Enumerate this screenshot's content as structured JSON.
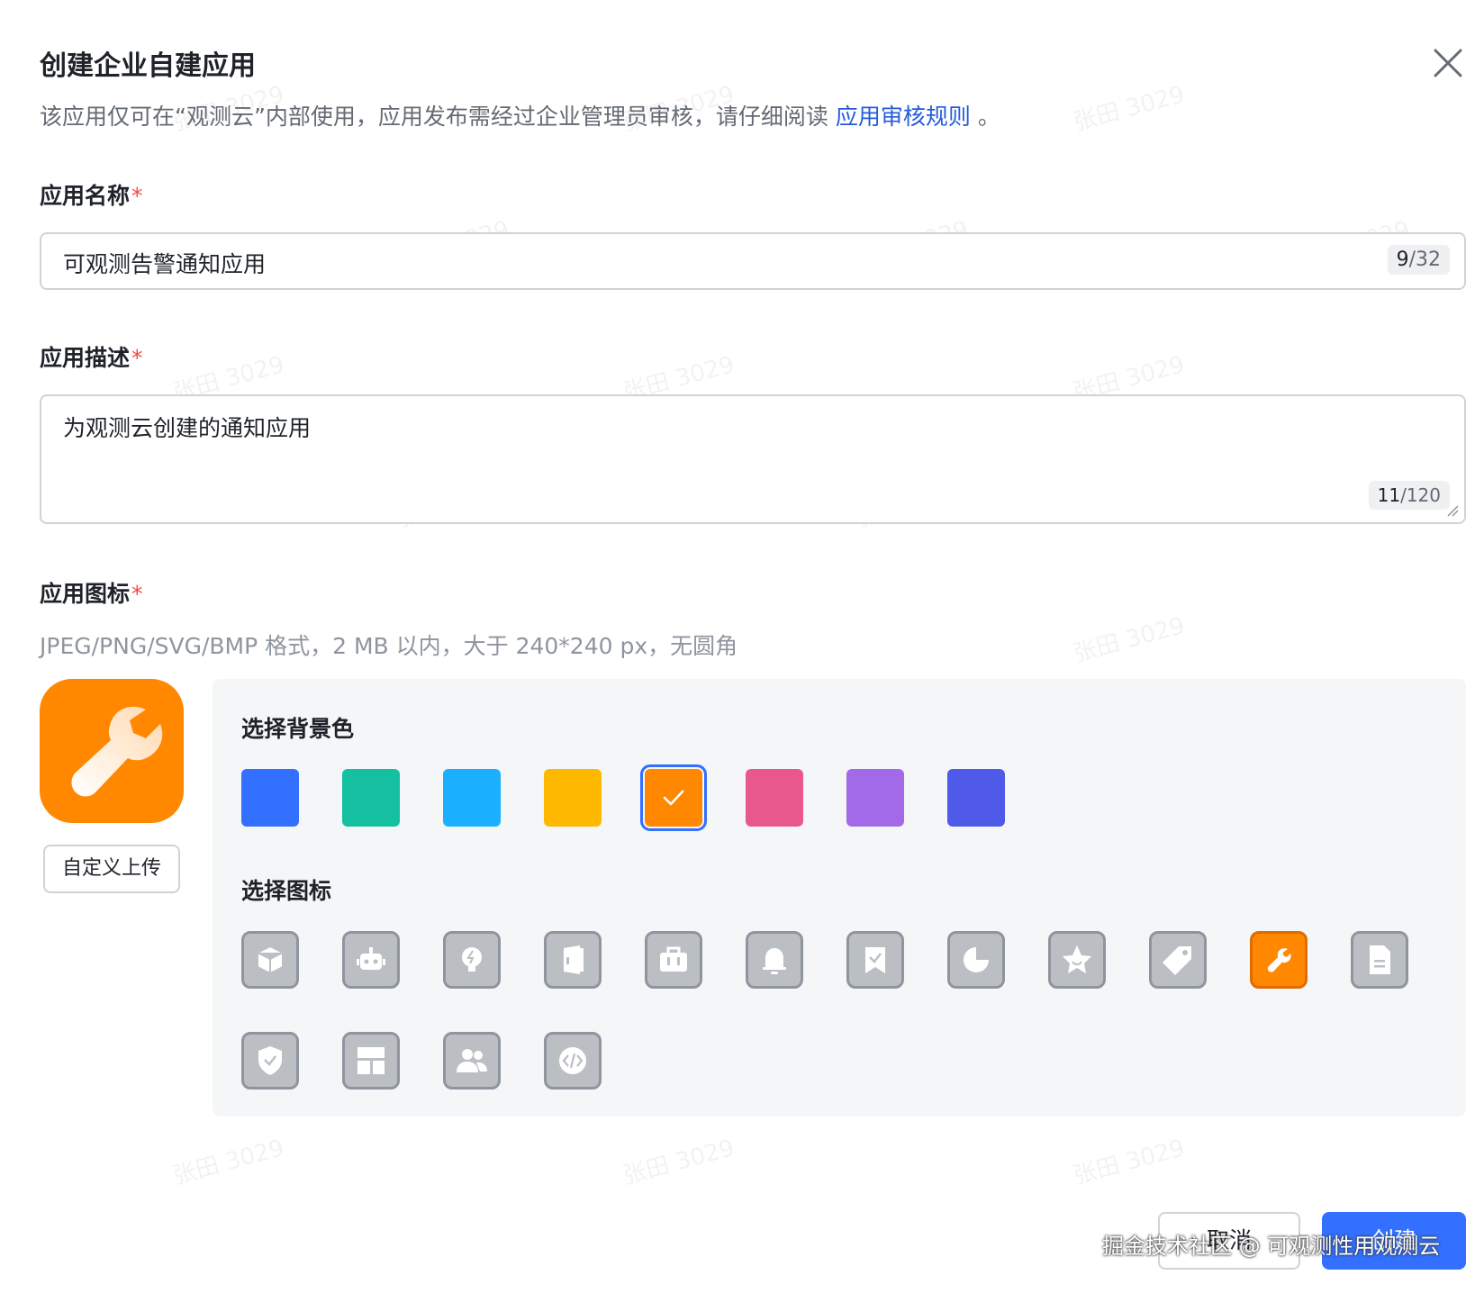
{
  "dialog": {
    "title": "创建企业自建应用",
    "subtitle_text": "该应用仅可在“观测云”内部使用，应用发布需经过企业管理员审核，请仔细阅读 ",
    "subtitle_link": "应用审核规则",
    "subtitle_end": " 。"
  },
  "name_field": {
    "label": "应用名称",
    "required_mark": "*",
    "value": "可观测告警通知应用",
    "count": "9",
    "max": "/32"
  },
  "desc_field": {
    "label": "应用描述",
    "required_mark": "*",
    "value": "为观测云创建的通知应用",
    "count": "11",
    "max": "/120"
  },
  "icon_field": {
    "label": "应用图标",
    "required_mark": "*",
    "hint": "JPEG/PNG/SVG/BMP 格式，2 MB 以内，大于 240*240 px，无圆角",
    "upload_label": "自定义上传"
  },
  "picker": {
    "bg_heading": "选择背景色",
    "icon_heading": "选择图标",
    "colors": [
      "#3370ff",
      "#14c0a0",
      "#1ab0ff",
      "#ffb800",
      "#ff8800",
      "#e8588a",
      "#a26ae8",
      "#4f5be8"
    ],
    "selected_color_index": 4,
    "icons": [
      "box-icon",
      "robot-icon",
      "lightbulb-icon",
      "door-icon",
      "briefcase-icon",
      "bell-icon",
      "bookmark-check-icon",
      "pie-chart-icon",
      "star-icon",
      "tag-icon",
      "wrench-icon",
      "document-icon",
      "shield-check-icon",
      "layout-icon",
      "users-icon",
      "code-icon"
    ],
    "selected_icon": "wrench-icon"
  },
  "footer": {
    "cancel_label": "取消",
    "create_label": "创建"
  },
  "watermark_text": "张田 3029",
  "site_mark": "掘金技术社区 @ 可观测性用观测云"
}
